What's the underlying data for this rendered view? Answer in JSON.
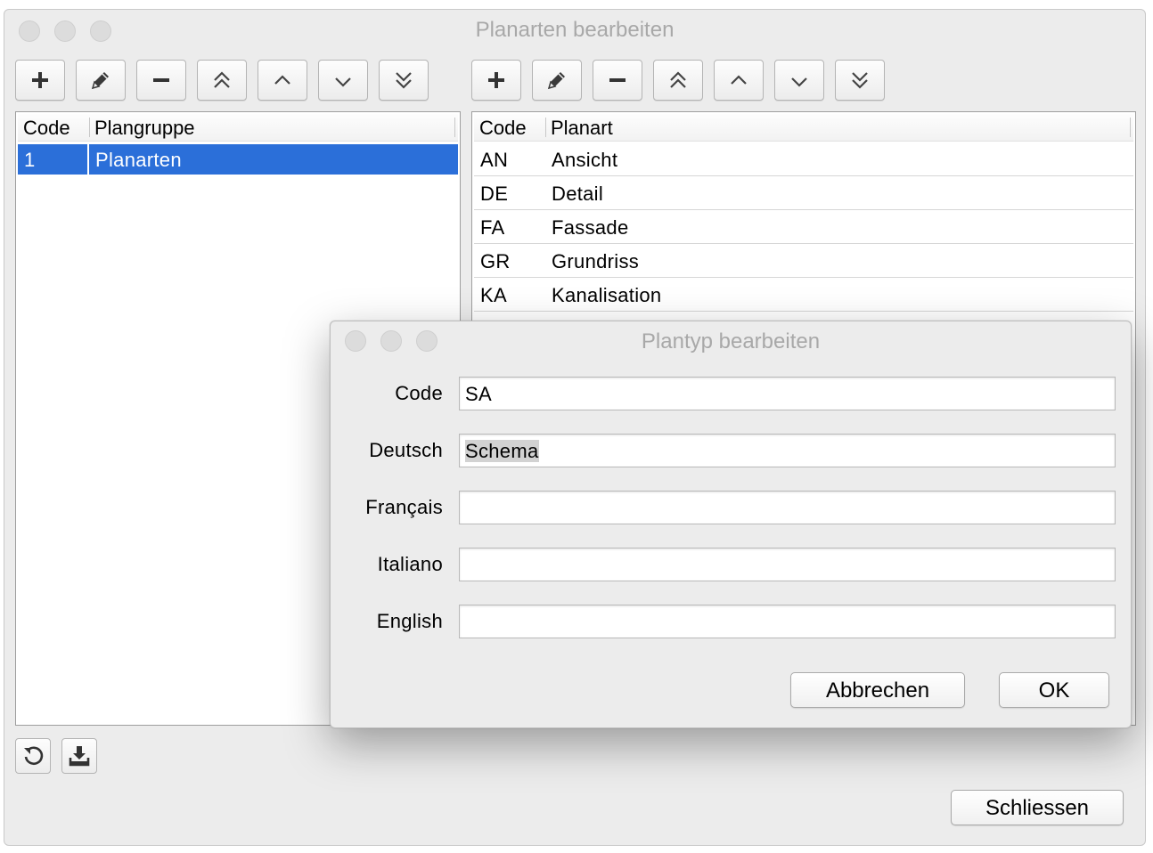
{
  "main_window": {
    "title": "Planarten bearbeiten",
    "left_toolbar": [
      "add-icon",
      "edit-icon",
      "remove-icon",
      "move-top-icon",
      "move-up-icon",
      "move-down-icon",
      "move-bottom-icon"
    ],
    "right_toolbar": [
      "add-icon",
      "edit-icon",
      "remove-icon",
      "move-top-icon",
      "move-up-icon",
      "move-down-icon",
      "move-bottom-icon"
    ],
    "group_table": {
      "columns": [
        "Code",
        "Plangruppe"
      ],
      "rows": [
        {
          "code": "1",
          "name": "Planarten",
          "selected": true
        }
      ]
    },
    "type_table": {
      "columns": [
        "Code",
        "Planart"
      ],
      "rows": [
        {
          "code": "AN",
          "name": "Ansicht"
        },
        {
          "code": "DE",
          "name": "Detail"
        },
        {
          "code": "FA",
          "name": "Fassade"
        },
        {
          "code": "GR",
          "name": "Grundriss"
        },
        {
          "code": "KA",
          "name": "Kanalisation"
        }
      ]
    },
    "bottom_icons": [
      "refresh-icon",
      "import-icon"
    ],
    "close_label": "Schliessen"
  },
  "dialog": {
    "title": "Plantyp bearbeiten",
    "fields": [
      {
        "label": "Code",
        "value": "SA"
      },
      {
        "label": "Deutsch",
        "value": "Schema"
      },
      {
        "label": "Français",
        "value": ""
      },
      {
        "label": "Italiano",
        "value": ""
      },
      {
        "label": "English",
        "value": ""
      }
    ],
    "cancel_label": "Abbrechen",
    "ok_label": "OK"
  },
  "colors": {
    "selection": "#2b6fd9",
    "window_bg": "#ececec",
    "title_text": "#a8a8a8"
  }
}
